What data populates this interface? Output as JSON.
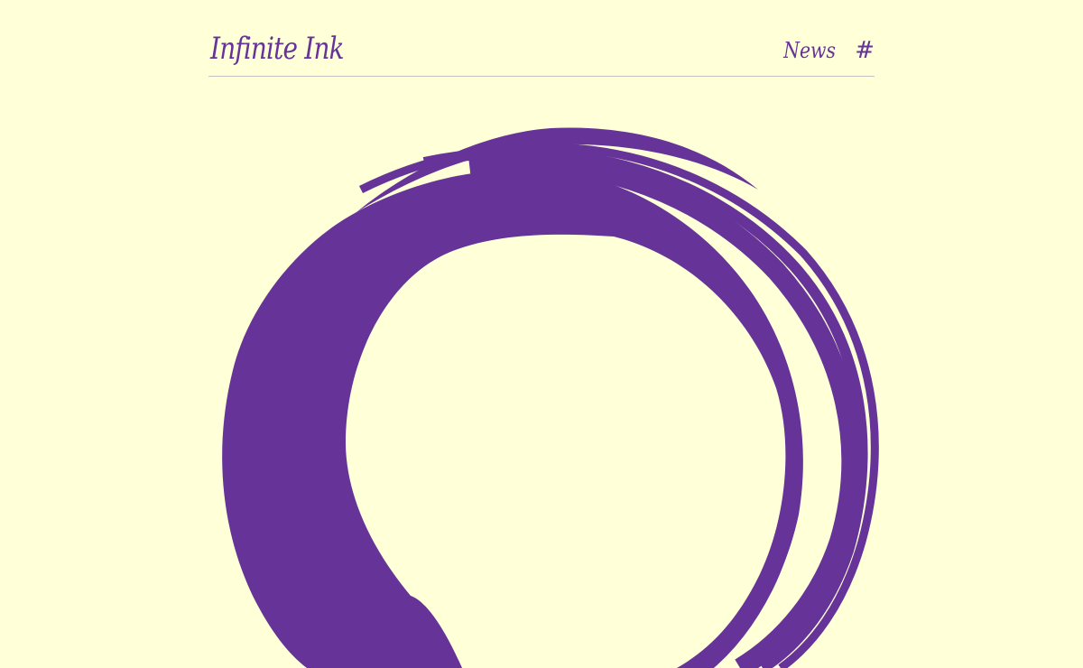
{
  "header": {
    "logo": "Infinite Ink",
    "nav": {
      "news_label": "News",
      "hash_glyph": "#"
    }
  },
  "colors": {
    "background": "#ffffd8",
    "accent": "#663399",
    "rule": "#c7c0c0"
  },
  "hero": {
    "icon": "enso-circle-icon"
  }
}
